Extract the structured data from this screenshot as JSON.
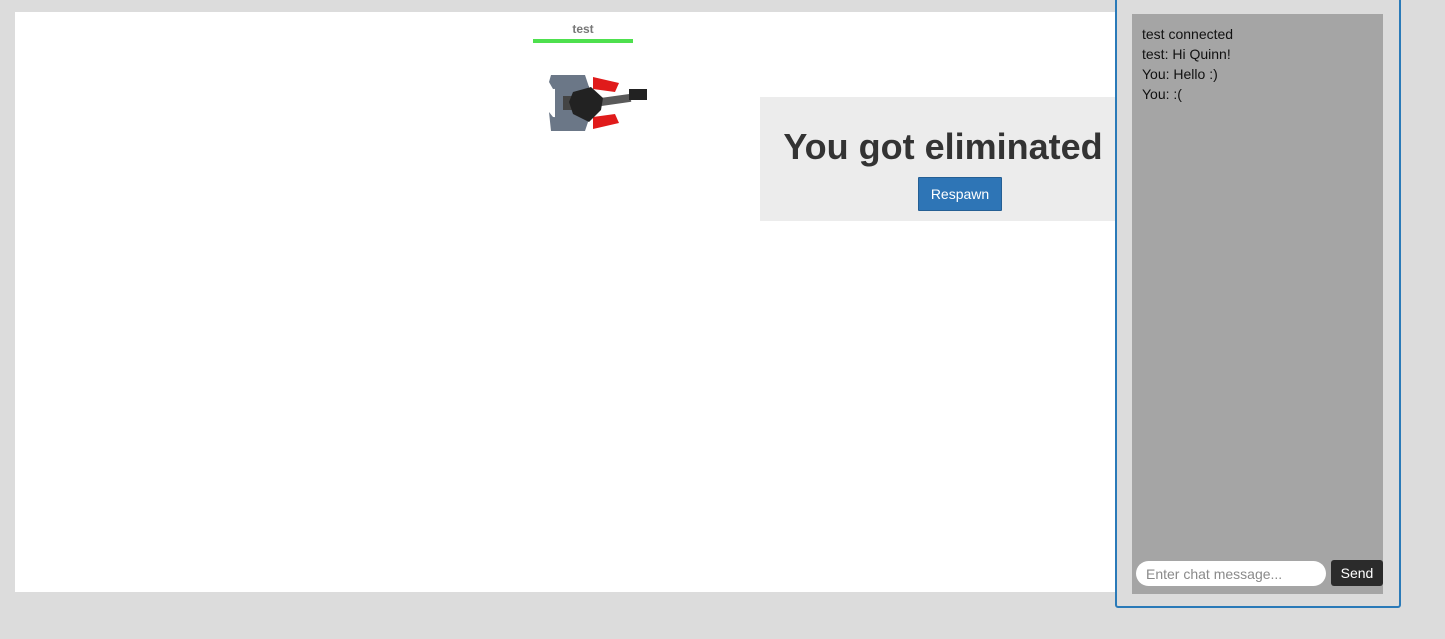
{
  "player": {
    "name": "test",
    "health_fraction": 1.0,
    "health_color": "#4ee04e"
  },
  "tank": {
    "body_color": "#6b7787",
    "turret_color": "#222222",
    "accent_color": "#e01b1b"
  },
  "overlay": {
    "title": "You got eliminated :(",
    "respawn_label": "Respawn"
  },
  "chat": {
    "messages": [
      "test connected",
      "test: Hi Quinn!",
      "You: Hello :)",
      "You: :("
    ],
    "input_value": "",
    "placeholder": "Enter chat message...",
    "send_label": "Send"
  },
  "colors": {
    "page_background": "#dcdcdc",
    "canvas_background": "#ffffff",
    "chat_border": "#2a7ab8",
    "chat_log_background": "#a5a5a5",
    "respawn_button": "#2e75b6"
  }
}
